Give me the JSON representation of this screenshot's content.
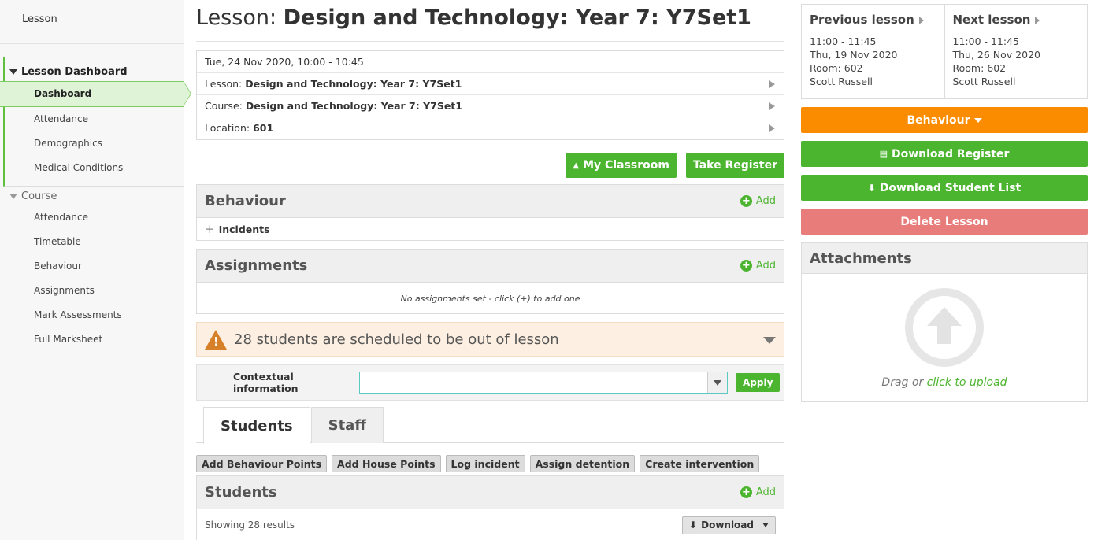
{
  "sidebar": {
    "title": "Lesson",
    "lesson_group": {
      "label": "Lesson Dashboard",
      "items": [
        "Dashboard",
        "Attendance",
        "Demographics",
        "Medical Conditions"
      ]
    },
    "course_group": {
      "label": "Course",
      "items": [
        "Attendance",
        "Timetable",
        "Behaviour",
        "Assignments",
        "Mark Assessments",
        "Full Marksheet"
      ]
    }
  },
  "header": {
    "prefix": "Lesson: ",
    "title": "Design and Technology: Year 7: Y7Set1"
  },
  "info": {
    "datetime": "Tue, 24 Nov 2020, 10:00 - 10:45",
    "lesson_label": "Lesson: ",
    "lesson_value": "Design and Technology: Year 7: Y7Set1",
    "course_label": "Course: ",
    "course_value": "Design and Technology: Year 7: Y7Set1",
    "location_label": "Location: ",
    "location_value": "601"
  },
  "buttons": {
    "my_classroom": "My Classroom",
    "take_register": "Take Register"
  },
  "behaviour": {
    "title": "Behaviour",
    "add": "Add",
    "incidents": "Incidents"
  },
  "assignments": {
    "title": "Assignments",
    "add": "Add",
    "empty": "No assignments set - click (+) to add one"
  },
  "alert": {
    "text": "28 students are scheduled to be out of lesson"
  },
  "context": {
    "label": "Contextual information",
    "value": "",
    "apply": "Apply"
  },
  "tabs": [
    "Students",
    "Staff"
  ],
  "actions": [
    "Add Behaviour Points",
    "Add House Points",
    "Log incident",
    "Assign detention",
    "Create intervention"
  ],
  "students": {
    "title": "Students",
    "add": "Add",
    "showing": "Showing 28 results",
    "download": "Download"
  },
  "prev_lesson": {
    "title": "Previous lesson",
    "time": "11:00 - 11:45",
    "date": "Thu, 19 Nov 2020",
    "room": "Room: 602",
    "teacher": "Scott Russell"
  },
  "next_lesson": {
    "title": "Next lesson",
    "time": "11:00 - 11:45",
    "date": "Thu, 26 Nov 2020",
    "room": "Room: 602",
    "teacher": "Scott Russell"
  },
  "right_buttons": {
    "behaviour": "Behaviour",
    "download_register": "Download Register",
    "download_student_list": "Download Student List",
    "delete_lesson": "Delete Lesson"
  },
  "attachments": {
    "title": "Attachments",
    "drag": "Drag or ",
    "click": "click to upload"
  },
  "colors": {
    "accent_green": "#4cb52f",
    "orange": "#fb8c00",
    "danger": "#e77c7b"
  }
}
